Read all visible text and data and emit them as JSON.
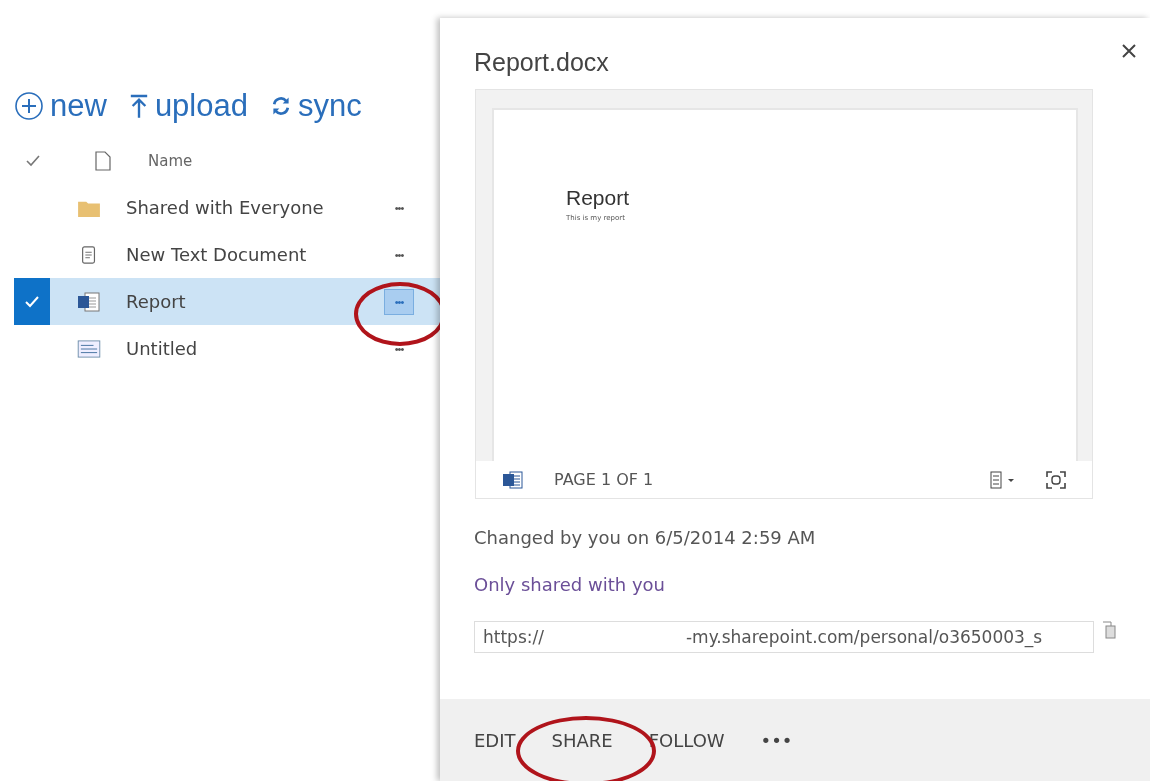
{
  "toolbar": [
    {
      "kind": "new",
      "label": "new"
    },
    {
      "kind": "upload",
      "label": "upload"
    },
    {
      "kind": "sync",
      "label": "sync"
    }
  ],
  "list": {
    "header": "Name",
    "rows": [
      {
        "kind": "folder",
        "name": "Shared with Everyone",
        "more": "•••",
        "selected": false
      },
      {
        "kind": "text",
        "name": "New Text Document",
        "more": "•••",
        "selected": false
      },
      {
        "kind": "word",
        "name": "Report",
        "more": "•••",
        "selected": true
      },
      {
        "kind": "image",
        "name": "Untitled",
        "more": "•••",
        "selected": false
      }
    ]
  },
  "panel": {
    "title": "Report.docx",
    "preview": {
      "heading": "Report",
      "subtitle": "This is my report",
      "page": "PAGE 1 OF 1"
    },
    "changed": "Changed by you on 6/5/2014 2:59 AM",
    "sharing": "Only shared with you",
    "url_prefix": "https://",
    "url_rest": "-my.sharepoint.com/personal/o3650003_s",
    "actions": [
      "EDIT",
      "SHARE",
      "FOLLOW",
      "•••"
    ]
  }
}
